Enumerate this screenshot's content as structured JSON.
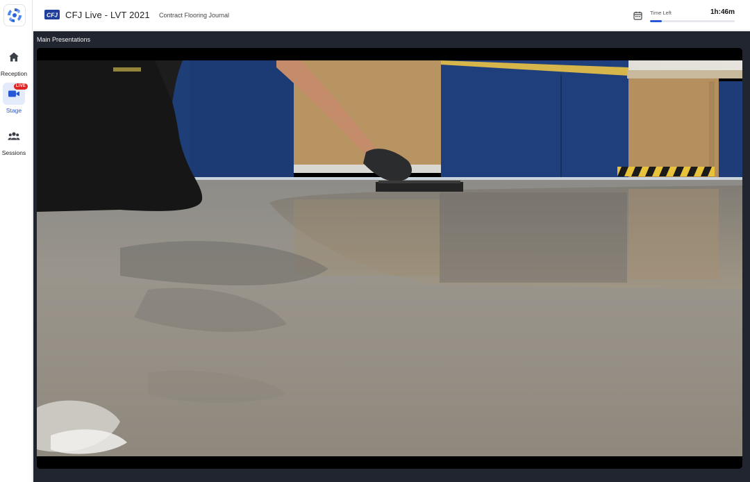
{
  "app": {
    "event_title": "CFJ Live - LVT 2021",
    "org_name": "Contract Flooring Journal",
    "logo_text": "CFJ"
  },
  "sidebar": {
    "items": [
      {
        "label": "Reception",
        "icon": "home-icon",
        "active": false
      },
      {
        "label": "Stage",
        "icon": "video-camera-icon",
        "active": true,
        "badge": "LIVE"
      },
      {
        "label": "Sessions",
        "icon": "people-group-icon",
        "active": false
      }
    ]
  },
  "header": {
    "time_left_label": "Time Left",
    "time_left_value": "1h:46m",
    "time_progress": 0.14
  },
  "main": {
    "section_title": "Main Presentations"
  },
  "colors": {
    "accent": "#2857d6",
    "live_badge": "#e02424",
    "main_bg": "#202530"
  }
}
